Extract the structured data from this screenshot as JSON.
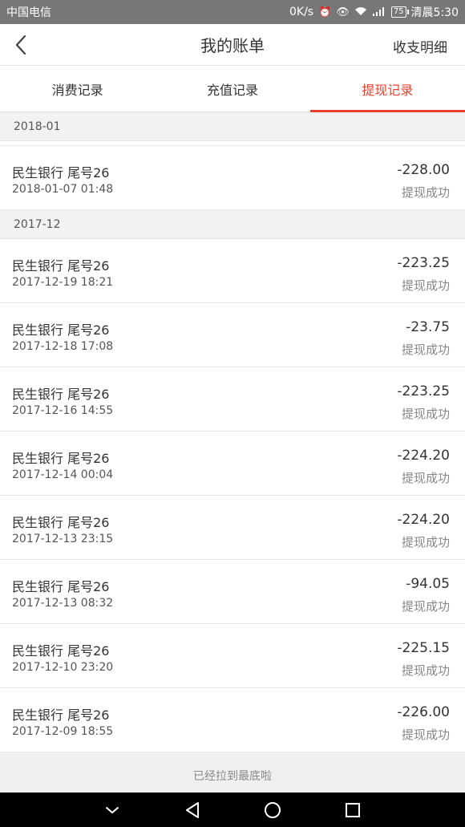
{
  "status_bar": {
    "carrier": "中国电信",
    "net_speed": "0K/s",
    "battery_level": "75",
    "time": "清晨5:30",
    "icons": [
      "alarm-icon",
      "eye-icon",
      "wifi-icon",
      "signal-icon",
      "battery-icon"
    ]
  },
  "header": {
    "title": "我的账单",
    "right_link": "收支明细",
    "back_icon": "chevron-left-icon"
  },
  "tabs": [
    {
      "label": "消费记录",
      "active": false
    },
    {
      "label": "充值记录",
      "active": false
    },
    {
      "label": "提现记录",
      "active": true
    }
  ],
  "accent_color": "#e8412e",
  "groups": [
    {
      "month": "2018-01",
      "items": [
        {
          "bank": "民生银行 尾号26",
          "date": "2018-01-07 01:48",
          "amount": "-228.00",
          "status": "提现成功"
        }
      ]
    },
    {
      "month": "2017-12",
      "items": [
        {
          "bank": "民生银行 尾号26",
          "date": "2017-12-19 18:21",
          "amount": "-223.25",
          "status": "提现成功"
        },
        {
          "bank": "民生银行 尾号26",
          "date": "2017-12-18 17:08",
          "amount": "-23.75",
          "status": "提现成功"
        },
        {
          "bank": "民生银行 尾号26",
          "date": "2017-12-16 14:55",
          "amount": "-223.25",
          "status": "提现成功"
        },
        {
          "bank": "民生银行 尾号26",
          "date": "2017-12-14 00:04",
          "amount": "-224.20",
          "status": "提现成功"
        },
        {
          "bank": "民生银行 尾号26",
          "date": "2017-12-13 23:15",
          "amount": "-224.20",
          "status": "提现成功"
        },
        {
          "bank": "民生银行 尾号26",
          "date": "2017-12-13 08:32",
          "amount": "-94.05",
          "status": "提现成功"
        },
        {
          "bank": "民生银行 尾号26",
          "date": "2017-12-10 23:20",
          "amount": "-225.15",
          "status": "提现成功"
        },
        {
          "bank": "民生银行 尾号26",
          "date": "2017-12-09 18:55",
          "amount": "-226.00",
          "status": "提现成功"
        }
      ]
    }
  ],
  "footer_note": "已经拉到最底啦",
  "system_nav": [
    "hide-keyboard-icon",
    "back-triangle-icon",
    "home-circle-icon",
    "recents-square-icon"
  ]
}
